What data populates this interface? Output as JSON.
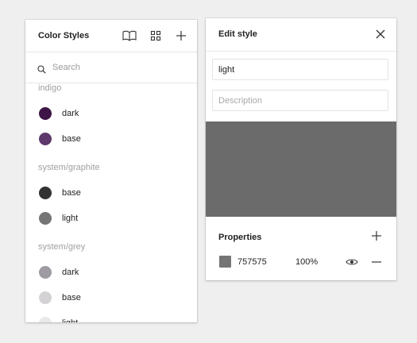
{
  "color_styles": {
    "title": "Color Styles",
    "icons": [
      "book-icon",
      "grid-icon",
      "plus-icon"
    ],
    "search": {
      "placeholder": "Search",
      "value": ""
    },
    "groups": [
      {
        "label": "indigo",
        "items": [
          {
            "name": "dark",
            "color": "#3d1446"
          },
          {
            "name": "base",
            "color": "#5d3a6b"
          }
        ]
      },
      {
        "label": "system/graphite",
        "items": [
          {
            "name": "base",
            "color": "#333333"
          },
          {
            "name": "light",
            "color": "#757575"
          }
        ]
      },
      {
        "label": "system/grey",
        "items": [
          {
            "name": "dark",
            "color": "#a09aa3"
          },
          {
            "name": "base",
            "color": "#d4d2d5"
          },
          {
            "name": "light",
            "color": "#e9e8ea"
          }
        ]
      }
    ]
  },
  "edit_style": {
    "title": "Edit style",
    "name_value": "light",
    "description_placeholder": "Description",
    "preview_color": "#6b6b6b",
    "properties": {
      "title": "Properties",
      "fill": {
        "hex": "757575",
        "opacity": "100%",
        "color": "#757575"
      }
    }
  }
}
